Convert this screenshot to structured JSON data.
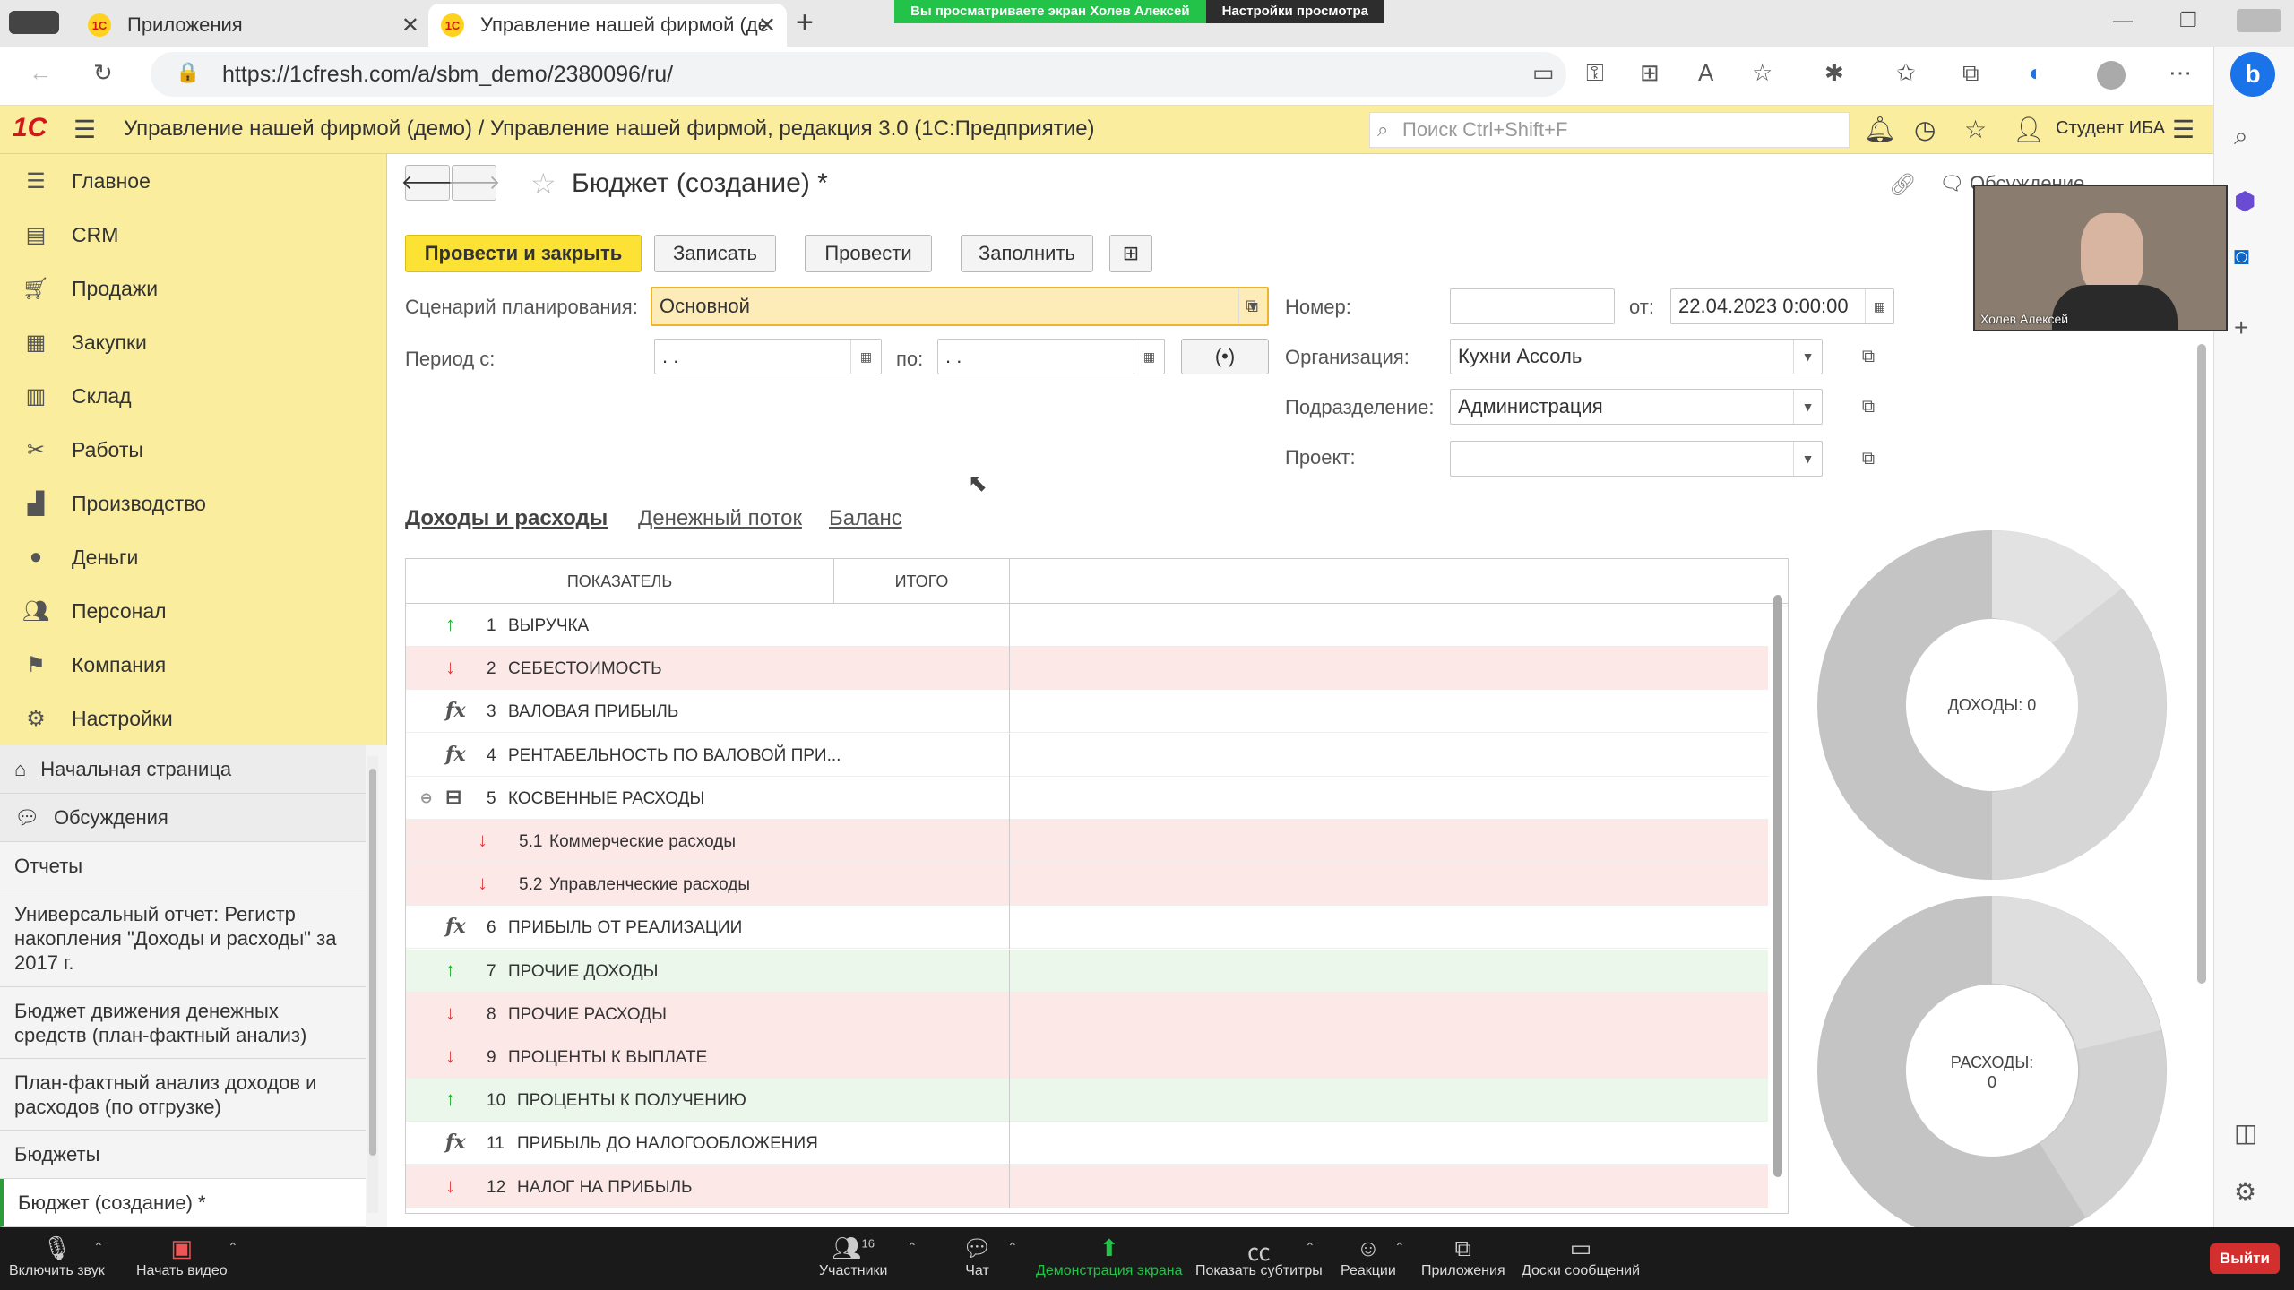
{
  "browser": {
    "tabs": [
      {
        "label": "Приложения"
      },
      {
        "label": "Управление нашей фирмой (де"
      }
    ],
    "url": "https://1cfresh.com/a/sbm_demo/2380096/ru/",
    "share_banner": {
      "viewing": "Вы просматриваете экран Холев Алексей",
      "settings": "Настройки просмотра"
    }
  },
  "app": {
    "title": "Управление нашей фирмой (демо) / Управление нашей фирмой, редакция 3.0  (1С:Предприятие)",
    "search_placeholder": "Поиск Ctrl+Shift+F",
    "user": "Студент ИБА",
    "logo": "1С"
  },
  "sidebar": {
    "items": [
      {
        "label": "Главное",
        "icon": "menu-icon"
      },
      {
        "label": "CRM",
        "icon": "crm-icon"
      },
      {
        "label": "Продажи",
        "icon": "sales-icon"
      },
      {
        "label": "Закупки",
        "icon": "purchases-icon"
      },
      {
        "label": "Склад",
        "icon": "warehouse-icon"
      },
      {
        "label": "Работы",
        "icon": "tools-icon"
      },
      {
        "label": "Производство",
        "icon": "factory-icon"
      },
      {
        "label": "Деньги",
        "icon": "money-icon"
      },
      {
        "label": "Персонал",
        "icon": "people-icon"
      },
      {
        "label": "Компания",
        "icon": "flag-icon"
      },
      {
        "label": "Настройки",
        "icon": "gear-icon"
      }
    ],
    "open_windows": [
      {
        "label": "Начальная страница"
      },
      {
        "label": "Обсуждения"
      },
      {
        "label": "Отчеты"
      },
      {
        "label": "Универсальный отчет: Регистр накопления \"Доходы и расходы\" за 2017 г."
      },
      {
        "label": "Бюджет движения денежных средств (план-фактный анализ)"
      },
      {
        "label": "План-фактный анализ доходов и расходов (по отгрузке)"
      },
      {
        "label": "Бюджеты"
      },
      {
        "label": "Бюджет (создание) *"
      }
    ]
  },
  "form": {
    "title": "Бюджет (создание) *",
    "discussion": "Обсуждение",
    "buttons": {
      "post_close": "Провести и закрыть",
      "save": "Записать",
      "post": "Провести",
      "fill": "Заполнить"
    },
    "fields": {
      "scenario_label": "Сценарий планирования:",
      "scenario_value": "Основной",
      "period_from_label": "Период с:",
      "period_from_value": " .  .",
      "period_to_label": "по:",
      "period_to_value": " .  .",
      "number_label": "Номер:",
      "number_value": "",
      "date_label": "от:",
      "date_value": "22.04.2023  0:00:00",
      "org_label": "Организация:",
      "org_value": "Кухни Ассоль",
      "dept_label": "Подразделение:",
      "dept_value": "Администрация",
      "project_label": "Проект:",
      "project_value": ""
    },
    "tabs": [
      {
        "label": "Доходы и расходы"
      },
      {
        "label": "Денежный поток"
      },
      {
        "label": "Баланс"
      }
    ]
  },
  "grid": {
    "headers": [
      "ПОКАЗАТЕЛЬ",
      "ИТОГО"
    ],
    "rows": [
      {
        "num": "1",
        "name": "ВЫРУЧКА",
        "kind": "up",
        "style": "plain"
      },
      {
        "num": "2",
        "name": "СЕБЕСТОИМОСТЬ",
        "kind": "down",
        "style": "red"
      },
      {
        "num": "3",
        "name": "ВАЛОВАЯ ПРИБЫЛЬ",
        "kind": "fx",
        "style": "plain"
      },
      {
        "num": "4",
        "name": "РЕНТАБЕЛЬНОСТЬ ПО ВАЛОВОЙ ПРИ...",
        "kind": "fx",
        "style": "plain"
      },
      {
        "num": "5",
        "name": "КОСВЕННЫЕ РАСХОДЫ",
        "kind": "group",
        "style": "plain"
      },
      {
        "num": "5.1",
        "name": "Коммерческие расходы",
        "kind": "down",
        "style": "red",
        "child": true
      },
      {
        "num": "5.2",
        "name": "Управленческие расходы",
        "kind": "down",
        "style": "red",
        "child": true
      },
      {
        "num": "6",
        "name": "ПРИБЫЛЬ ОТ РЕАЛИЗАЦИИ",
        "kind": "fx",
        "style": "plain"
      },
      {
        "num": "7",
        "name": "ПРОЧИЕ ДОХОДЫ",
        "kind": "up",
        "style": "green"
      },
      {
        "num": "8",
        "name": "ПРОЧИЕ РАСХОДЫ",
        "kind": "down",
        "style": "red"
      },
      {
        "num": "9",
        "name": "ПРОЦЕНТЫ К ВЫПЛАТЕ",
        "kind": "down",
        "style": "red"
      },
      {
        "num": "10",
        "name": "ПРОЦЕНТЫ К ПОЛУЧЕНИЮ",
        "kind": "up",
        "style": "green"
      },
      {
        "num": "11",
        "name": "ПРИБЫЛЬ ДО НАЛОГООБЛОЖЕНИЯ",
        "kind": "fx",
        "style": "plain"
      },
      {
        "num": "12",
        "name": "НАЛОГ НА ПРИБЫЛЬ",
        "kind": "down",
        "style": "red"
      }
    ]
  },
  "charts": {
    "income_label": "ДОХОДЫ: 0",
    "expense_label_line1": "РАСХОДЫ:",
    "expense_label_line2": "0"
  },
  "webcam": {
    "name": "Холев Алексей"
  },
  "zoom": {
    "items": [
      {
        "label": "Включить звук",
        "icon": "mic-muted-icon"
      },
      {
        "label": "Начать видео",
        "icon": "video-off-icon"
      },
      {
        "label": "Участники",
        "icon": "participants-icon",
        "count": "16"
      },
      {
        "label": "Чат",
        "icon": "chat-icon"
      },
      {
        "label": "Демонстрация экрана",
        "icon": "share-screen-icon"
      },
      {
        "label": "Показать субтитры",
        "icon": "cc-icon"
      },
      {
        "label": "Реакции",
        "icon": "reactions-icon"
      },
      {
        "label": "Приложения",
        "icon": "apps-icon"
      },
      {
        "label": "Доски сообщений",
        "icon": "whiteboard-icon"
      }
    ],
    "leave": "Выйти"
  }
}
